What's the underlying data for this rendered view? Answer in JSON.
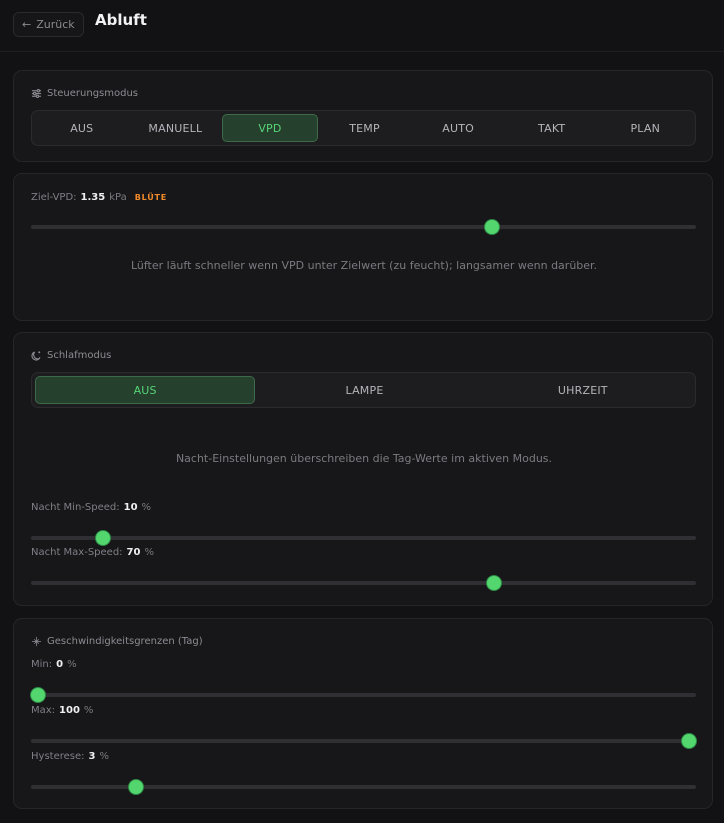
{
  "header": {
    "back_label": "Zurück",
    "title": "Abluft"
  },
  "control_mode": {
    "title": "Steuerungsmodus",
    "options": [
      "AUS",
      "MANUELL",
      "VPD",
      "TEMP",
      "AUTO",
      "TAKT",
      "PLAN"
    ],
    "selected": "VPD"
  },
  "target_vpd": {
    "label": "Ziel-VPD:",
    "value": "1.35",
    "unit": "kPa",
    "phase_badge": "BLÜTE",
    "slider_fraction": 0.697,
    "hint": "Lüfter läuft schneller wenn VPD unter Zielwert (zu feucht); langsamer wenn darüber."
  },
  "sleep_mode": {
    "title": "Schlafmodus",
    "options": [
      "AUS",
      "LAMPE",
      "UHRZEIT"
    ],
    "selected": "AUS",
    "hint": "Nacht-Einstellungen überschreiben die Tag-Werte im aktiven Modus.",
    "night_min": {
      "label": "Nacht Min-Speed:",
      "value": 10,
      "unit": "%"
    },
    "night_max": {
      "label": "Nacht Max-Speed:",
      "value": 70,
      "unit": "%"
    }
  },
  "speed_limits": {
    "title": "Geschwindigkeitsgrenzen (Tag)",
    "min": {
      "label": "Min:",
      "value": 0,
      "unit": "%"
    },
    "max": {
      "label": "Max:",
      "value": 100,
      "unit": "%"
    },
    "hysteresis": {
      "label": "Hysterese:",
      "value": 3,
      "unit": "%",
      "max": 20
    }
  },
  "colors": {
    "accent": "#52d66d",
    "badge": "#f08a2a",
    "background": "#121214",
    "card": "#17171a"
  }
}
